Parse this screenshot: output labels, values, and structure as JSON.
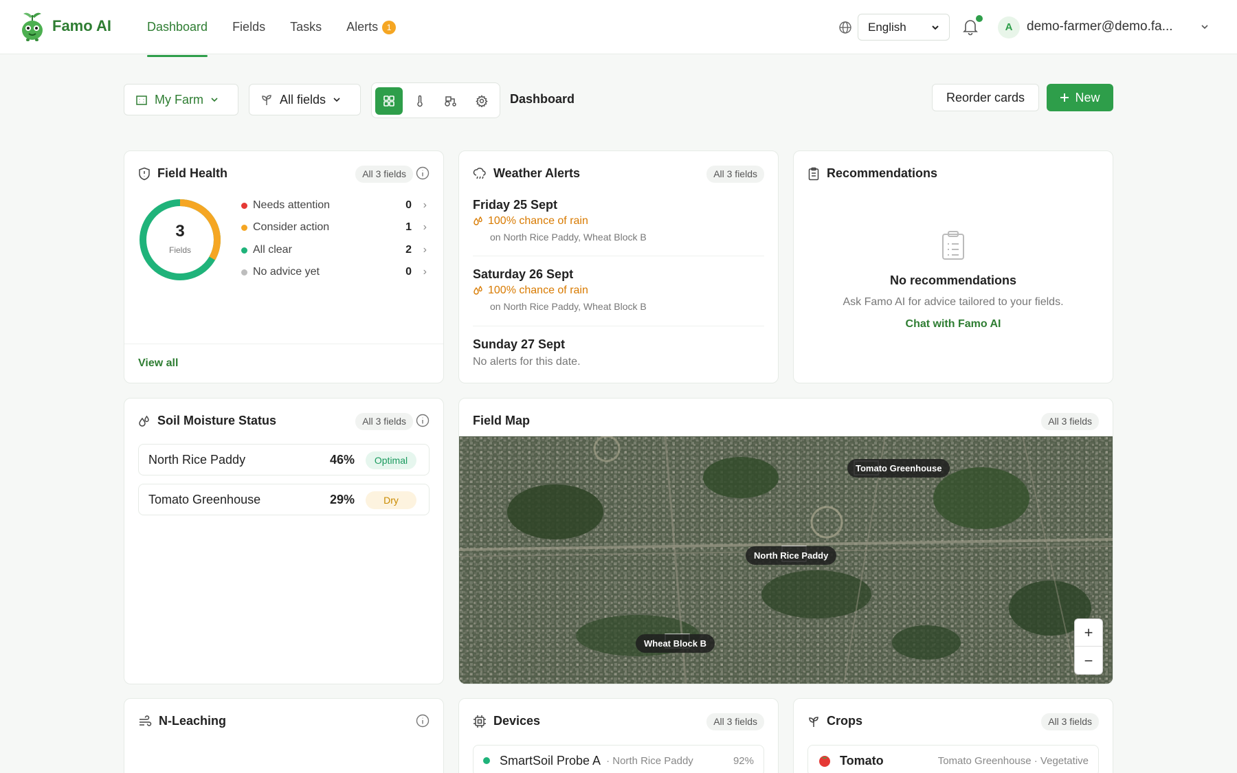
{
  "app": {
    "name": "Famo AI"
  },
  "nav": {
    "items": [
      {
        "label": "Dashboard"
      },
      {
        "label": "Fields"
      },
      {
        "label": "Tasks"
      },
      {
        "label": "Alerts",
        "badge": "1"
      }
    ]
  },
  "header": {
    "language": "English",
    "avatar_initial": "A",
    "user_email": "demo-farmer@demo.fa..."
  },
  "toolbar": {
    "farm": "My Farm",
    "fields": "All fields",
    "title": "Dashboard",
    "reorder_label": "Reorder cards",
    "new_label": "New"
  },
  "field_health": {
    "title": "Field Health",
    "chip": "All 3 fields",
    "total": "3",
    "total_label": "Fields",
    "rows": [
      {
        "label": "Needs attention",
        "count": "0",
        "color": "#e53935"
      },
      {
        "label": "Consider action",
        "count": "1",
        "color": "#f5a623"
      },
      {
        "label": "All clear",
        "count": "2",
        "color": "#1fb37a"
      },
      {
        "label": "No advice yet",
        "count": "0",
        "color": "#bdbdbd"
      }
    ],
    "view_all": "View all"
  },
  "weather": {
    "title": "Weather Alerts",
    "chip": "All 3 fields",
    "days": [
      {
        "date": "Friday 25 Sept",
        "chance": "100% chance of rain",
        "location": "on North Rice Paddy, Wheat Block B"
      },
      {
        "date": "Saturday 26 Sept",
        "chance": "100% chance of rain",
        "location": "on North Rice Paddy, Wheat Block B"
      },
      {
        "date": "Sunday 27 Sept",
        "none": "No alerts for this date."
      }
    ]
  },
  "recommendations": {
    "title": "Recommendations",
    "empty_title": "No recommendations",
    "empty_sub": "Ask Famo AI for advice tailored to your fields.",
    "link": "Chat with Famo AI"
  },
  "soil": {
    "title": "Soil Moisture Status",
    "chip": "All 3 fields",
    "rows": [
      {
        "name": "North Rice Paddy",
        "pct": "46%",
        "status": "Optimal"
      },
      {
        "name": "Tomato Greenhouse",
        "pct": "29%",
        "status": "Dry"
      }
    ]
  },
  "field_map": {
    "title": "Field Map",
    "chip": "All 3 fields",
    "labels": [
      "Tomato Greenhouse",
      "North Rice Paddy",
      "Wheat Block B"
    ],
    "zoom_in": "+",
    "zoom_out": "−"
  },
  "n_leaching": {
    "title": "N-Leaching"
  },
  "devices": {
    "title": "Devices",
    "chip": "All 3 fields",
    "rows": [
      {
        "name": "SmartSoil Probe A",
        "field": "· North Rice Paddy",
        "value": "92%"
      }
    ]
  },
  "crops": {
    "title": "Crops",
    "chip": "All 3 fields",
    "rows": [
      {
        "name": "Tomato",
        "detail": "Tomato Greenhouse · Vegetative"
      }
    ]
  },
  "colors": {
    "accent": "#2e9e4a",
    "warning": "#f5a623",
    "danger": "#e53935",
    "clear": "#1fb37a"
  }
}
